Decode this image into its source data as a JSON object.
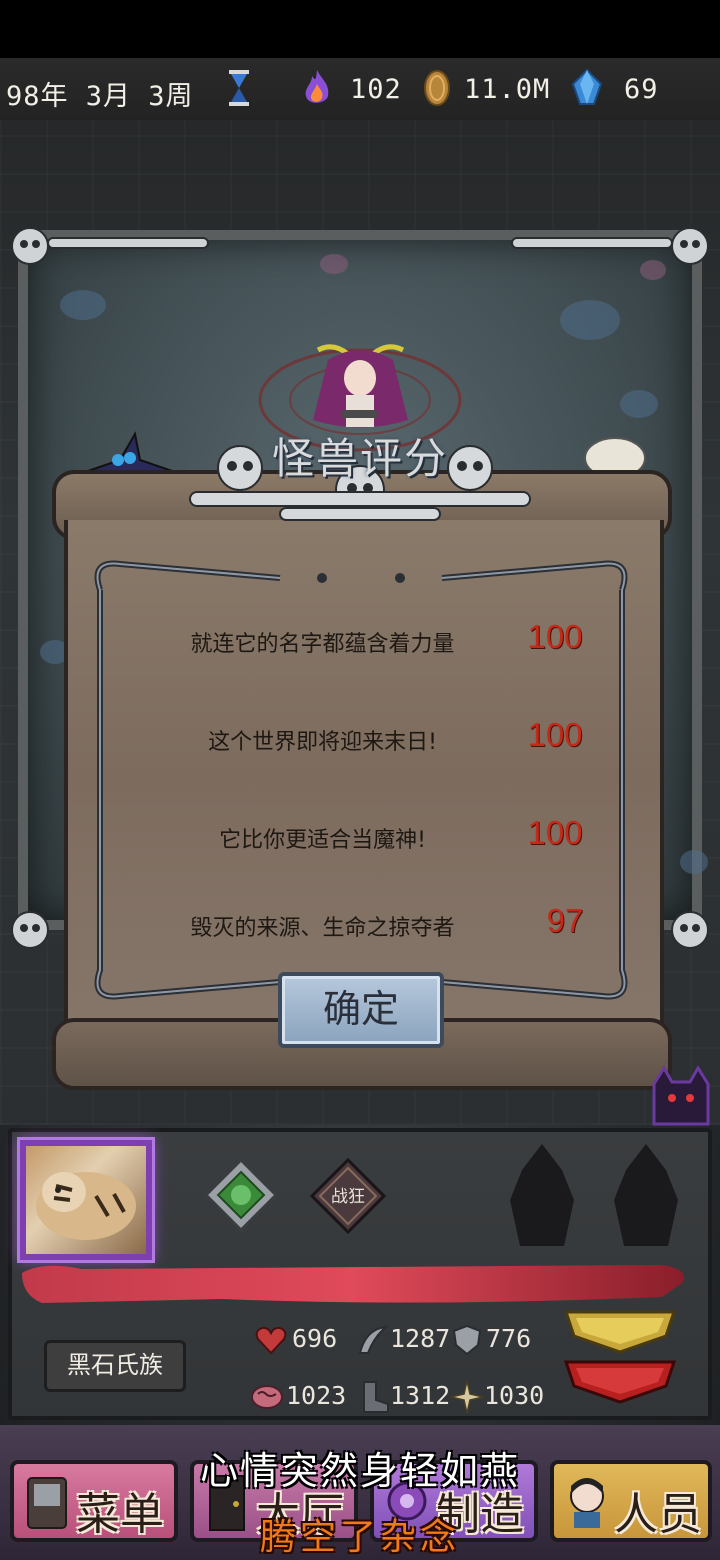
{
  "hud": {
    "date": "98年 3月 3周",
    "fire_value": "102",
    "gold_value": "11.0M",
    "crystal_value": "69"
  },
  "dialog": {
    "title": "怪兽评分",
    "rows": [
      {
        "label": "就连它的名字都蕴含着力量",
        "score": "100"
      },
      {
        "label": "这个世界即将迎来末日!",
        "score": "100"
      },
      {
        "label": "它比你更适合当魔神!",
        "score": "100"
      },
      {
        "label": "毁灭的来源、生命之掠夺者",
        "score": "97"
      }
    ],
    "confirm_label": "确定"
  },
  "monster_panel": {
    "trait_badge": "战狂",
    "clan": "黑石氏族",
    "stats": {
      "hp": "696",
      "attack": "1287",
      "defense": "776",
      "intellect": "1023",
      "speed": "1312",
      "magic": "1030"
    }
  },
  "nav": {
    "menu": "菜单",
    "hall": "大厅",
    "craft": "制造",
    "staff": "人员"
  },
  "toast": {
    "line1": "心情突然身轻如燕",
    "line2": "腾空了杂念"
  },
  "colors": {
    "score_red": "#c42a1a",
    "purple_frame": "#7e3fb0",
    "toast_orange": "#f07a1a"
  }
}
